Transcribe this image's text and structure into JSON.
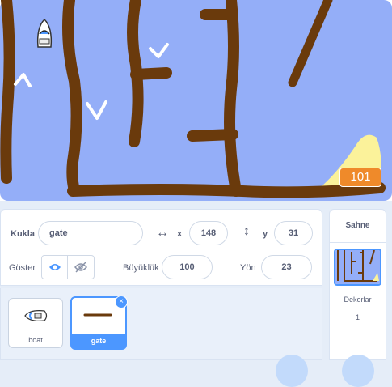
{
  "stage": {
    "counter_value": "101",
    "colors": {
      "water": "#94aef8",
      "wall": "#6a3a0c",
      "sand": "#fbf29a",
      "counter": "#ef8a2a"
    }
  },
  "sprite_info": {
    "sprite_label": "Kukla",
    "sprite_name": "gate",
    "x_label": "x",
    "x_value": "148",
    "y_label": "y",
    "y_value": "31",
    "show_label": "Göster",
    "size_label": "Büyüklük",
    "size_value": "100",
    "direction_label": "Yön",
    "direction_value": "23"
  },
  "sprites": [
    {
      "name": "boat",
      "selected": false
    },
    {
      "name": "gate",
      "selected": true
    }
  ],
  "stage_pane": {
    "title": "Sahne",
    "backdrops_label": "Dekorlar",
    "backdrops_count": "1"
  },
  "accent_color": "#4c97ff"
}
